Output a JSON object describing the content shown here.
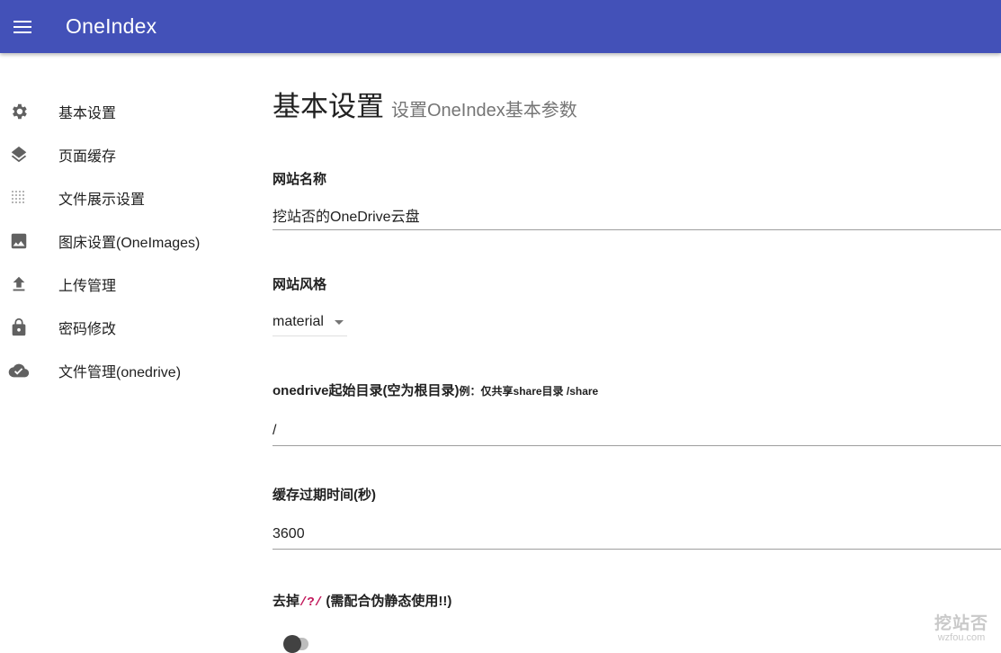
{
  "app": {
    "title": "OneIndex",
    "menu_icon": "menu-icon",
    "colors": {
      "appbar": "#4351b8",
      "accent_code": "#c2185b"
    }
  },
  "sidebar": {
    "items": [
      {
        "label": "基本设置",
        "icon": "gear-icon"
      },
      {
        "label": "页面缓存",
        "icon": "layers-icon"
      },
      {
        "label": "文件展示设置",
        "icon": "grid-dots-icon"
      },
      {
        "label": "图床设置(OneImages)",
        "icon": "image-icon"
      },
      {
        "label": "上传管理",
        "icon": "upload-icon"
      },
      {
        "label": "密码修改",
        "icon": "lock-icon"
      },
      {
        "label": "文件管理(onedrive)",
        "icon": "cloud-done-icon"
      }
    ]
  },
  "main": {
    "title": "基本设置",
    "subtitle": "设置OneIndex基本参数",
    "fields": {
      "site_name": {
        "label": "网站名称",
        "value": "挖站否的OneDrive云盘"
      },
      "site_style": {
        "label": "网站风格",
        "value": "material"
      },
      "root_dir": {
        "label": "onedrive起始目录(空为根目录)",
        "hint": "例：仅共享share目录 /share",
        "value": "/"
      },
      "cache_expire": {
        "label": "缓存过期时间(秒)",
        "value": "3600"
      },
      "remove_qs": {
        "label_prefix": "去掉",
        "label_code": "/?/",
        "label_suffix": " (需配合伪静态使用!!)",
        "enabled": false
      }
    }
  },
  "watermark": {
    "main": "挖站否",
    "sub": "wzfou.com"
  }
}
